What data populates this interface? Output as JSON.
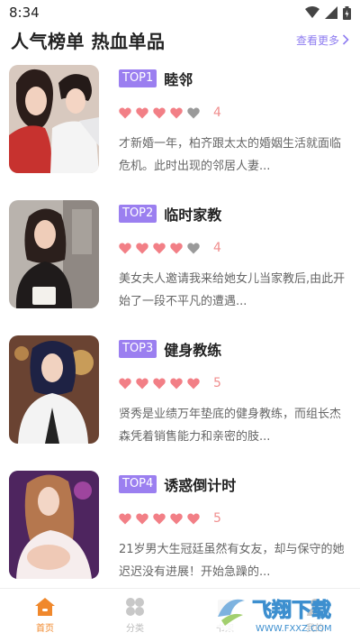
{
  "status_bar": {
    "time": "8:34"
  },
  "header": {
    "title": "人气榜单 热血单品",
    "more_label": "查看更多"
  },
  "items": [
    {
      "rank": "TOP1",
      "title": "睦邻",
      "rating": 4,
      "rating_label": "4",
      "description": "才新婚一年，柏齐跟太太的婚姻生活就面临危机。此时出现的邻居人妻..."
    },
    {
      "rank": "TOP2",
      "title": "临时家教",
      "rating": 4,
      "rating_label": "4",
      "description": "美女夫人邀请我来给她女儿当家教后,由此开始了一段不平凡的遭遇..."
    },
    {
      "rank": "TOP3",
      "title": "健身教练",
      "rating": 5,
      "rating_label": "5",
      "description": "贤秀是业绩万年垫底的健身教练，而组长杰森凭着销售能力和亲密的肢..."
    },
    {
      "rank": "TOP4",
      "title": "诱惑倒计时",
      "rating": 5,
      "rating_label": "5",
      "description": "21岁男大生冠廷虽然有女友，却与保守的她迟迟没有进展！开始急躁的..."
    }
  ],
  "tabbar": [
    {
      "label": "首页",
      "icon": "home-icon",
      "active": true
    },
    {
      "label": "分类",
      "icon": "category-icon",
      "active": false
    },
    {
      "label": "书架",
      "icon": "bookshelf-icon",
      "active": false
    },
    {
      "label": "我的",
      "icon": "profile-icon",
      "active": false
    }
  ],
  "watermark": {
    "text": "飞翔下载",
    "url": "WWW.FXXZ.COM"
  },
  "colors": {
    "accent": "#9b7ff0",
    "heart_on": "#f27f86",
    "heart_off": "#9a9a9a",
    "tab_active": "#f0882c"
  }
}
